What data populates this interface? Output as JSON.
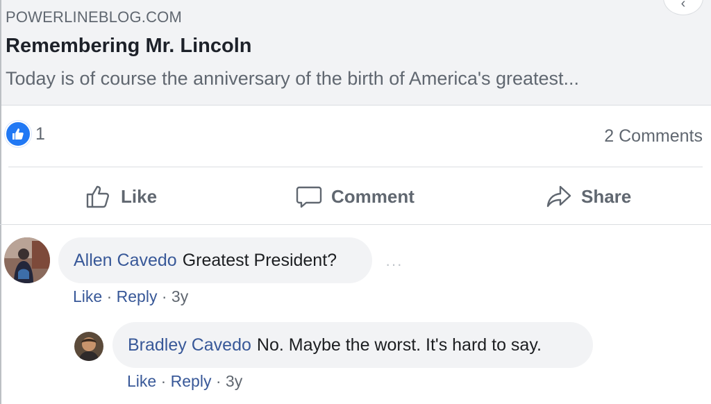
{
  "link_preview": {
    "domain": "POWERLINEBLOG.COM",
    "title": "Remembering Mr. Lincoln",
    "description": "Today is of course the anniversary of the birth of America's greatest..."
  },
  "reactions": {
    "like_count": "1",
    "comments_count": "2 Comments"
  },
  "actions": {
    "like": "Like",
    "comment": "Comment",
    "share": "Share"
  },
  "comments": [
    {
      "author": "Allen Cavedo",
      "text": "Greatest President?",
      "like": "Like",
      "reply": "Reply",
      "time": "3y",
      "options": "···"
    },
    {
      "author": "Bradley Cavedo",
      "text": "No. Maybe the worst. It's hard to say.",
      "like": "Like",
      "reply": "Reply",
      "time": "3y"
    }
  ],
  "colors": {
    "accent_blue": "#385898",
    "like_blue": "#2078f4",
    "secondary_text": "#606770",
    "bubble_bg": "#f2f3f5"
  }
}
